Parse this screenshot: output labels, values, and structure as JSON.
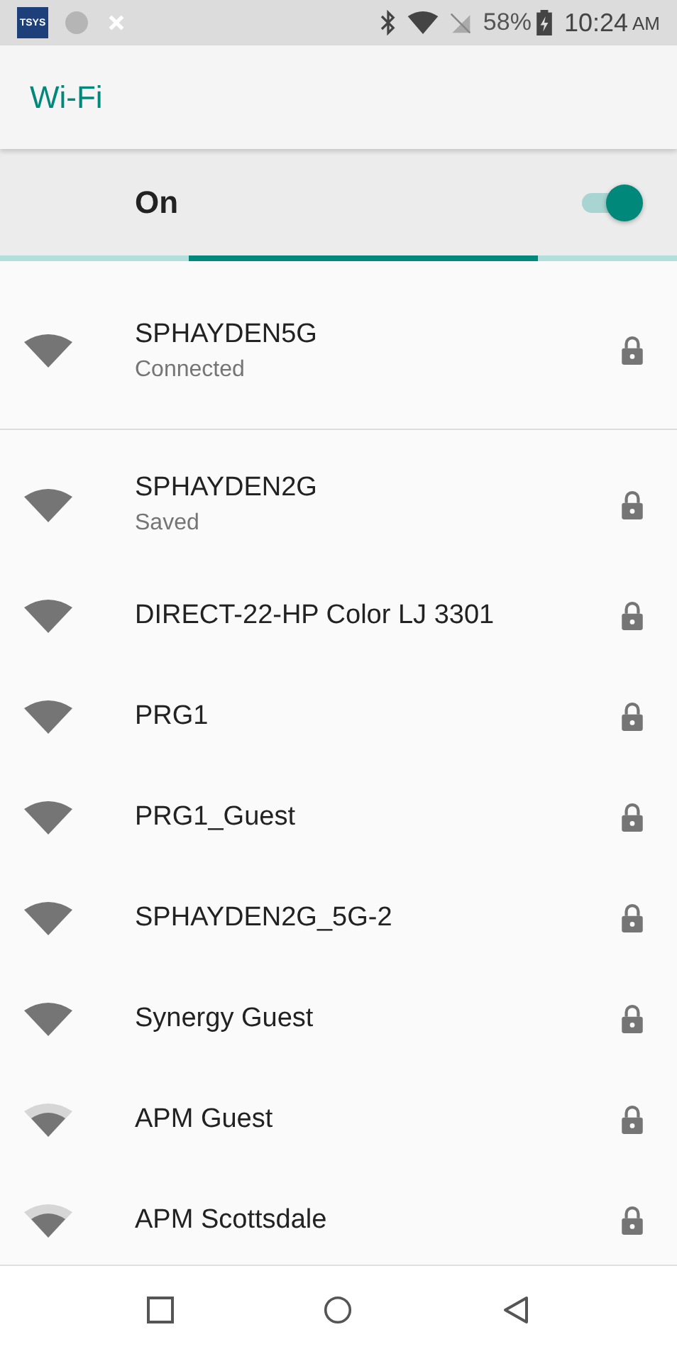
{
  "status_bar": {
    "app_logo": "TSYS",
    "battery": "58%",
    "time": "10:24",
    "meridiem": "AM"
  },
  "app_bar": {
    "title": "Wi-Fi"
  },
  "switch_bar": {
    "label": "On",
    "on": true
  },
  "connected": [
    {
      "name": "SPHAYDEN5G",
      "status": "Connected",
      "locked": true,
      "kind": "strong"
    }
  ],
  "networks": [
    {
      "name": "SPHAYDEN2G",
      "status": "Saved",
      "locked": true,
      "kind": "strong"
    },
    {
      "name": "DIRECT-22-HP Color LJ 3301",
      "locked": true,
      "kind": "strong"
    },
    {
      "name": "PRG1",
      "locked": true,
      "kind": "strong"
    },
    {
      "name": "PRG1_Guest",
      "locked": true,
      "kind": "strong"
    },
    {
      "name": "SPHAYDEN2G_5G-2",
      "locked": true,
      "kind": "strong"
    },
    {
      "name": "Synergy Guest",
      "locked": true,
      "kind": "strong"
    },
    {
      "name": "APM Guest",
      "locked": true,
      "kind": "medium"
    },
    {
      "name": "APM Scottsdale",
      "locked": true,
      "kind": "medium"
    }
  ]
}
